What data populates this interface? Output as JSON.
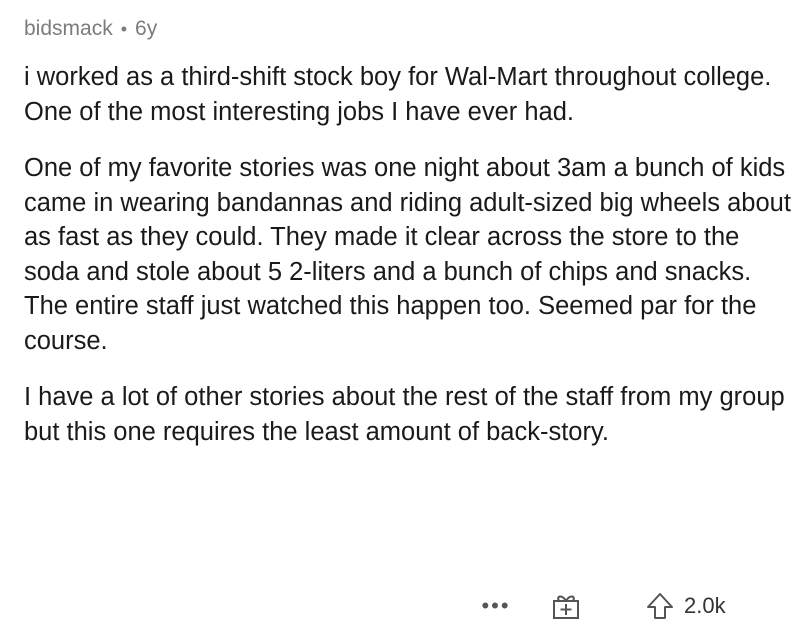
{
  "comment": {
    "author": "bidsmack",
    "separator": "•",
    "age": "6y",
    "paragraphs": [
      "i worked as a third-shift stock boy for Wal-Mart throughout college. One of the most interesting jobs I have ever had.",
      "One of my favorite stories was one night about 3am a bunch of kids came in wearing bandannas and riding adult-sized big wheels about as fast as they could. They made it clear across the store to the soda and stole about 5 2-liters and a bunch of chips and snacks. The entire staff just watched this happen too. Seemed par for the course.",
      "I have a lot of other stories about the rest of the staff from my group but this one requires the least amount of back-story."
    ]
  },
  "actions": {
    "more_label": "•••",
    "award_icon": "gift-icon",
    "upvote_icon": "upvote-arrow-icon",
    "score": "2.0k"
  },
  "colors": {
    "meta_text": "#7c7c7c",
    "body_text": "#1a1a1b",
    "icon": "#555555"
  }
}
